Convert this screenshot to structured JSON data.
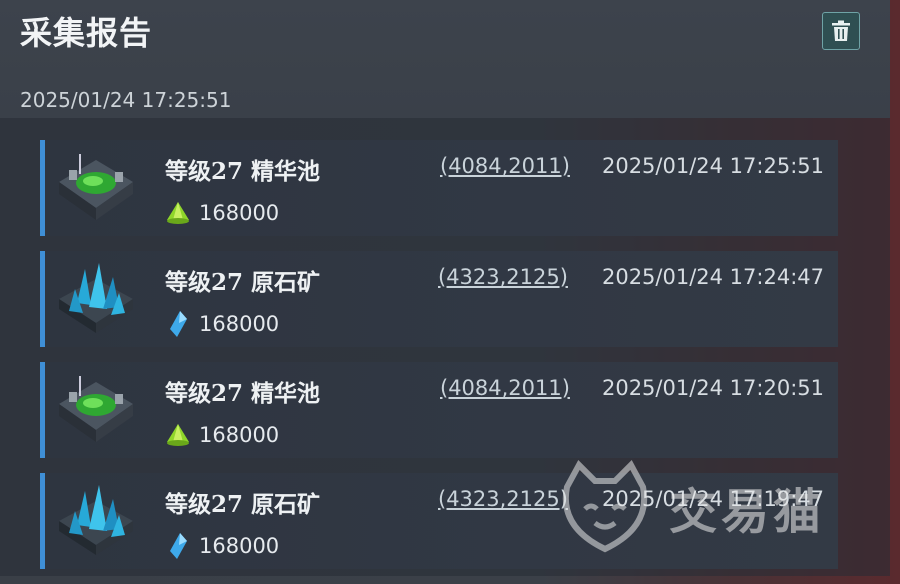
{
  "header": {
    "title": "采集报告",
    "date": "2025/01/24  17:25:51",
    "trash_icon": "trash-icon"
  },
  "reports": [
    {
      "title": "等级27  精华池",
      "coords": "(4084,2011)",
      "time": "2025/01/24 17:25:51",
      "amount": "168000",
      "icon": "essence-pool",
      "resource_icon": "green-essence-icon"
    },
    {
      "title": "等级27  原石矿",
      "coords": "(4323,2125)",
      "time": "2025/01/24 17:24:47",
      "amount": "168000",
      "icon": "crystal-mine",
      "resource_icon": "blue-crystal-icon"
    },
    {
      "title": "等级27  精华池",
      "coords": "(4084,2011)",
      "time": "2025/01/24 17:20:51",
      "amount": "168000",
      "icon": "essence-pool",
      "resource_icon": "green-essence-icon"
    },
    {
      "title": "等级27  原石矿",
      "coords": "(4323,2125)",
      "time": "2025/01/24 17:19:47",
      "amount": "168000",
      "icon": "crystal-mine",
      "resource_icon": "blue-crystal-icon"
    }
  ],
  "watermark": {
    "text": "交易猫"
  },
  "colors": {
    "accent": "#3f8fd6",
    "button": "#2f4f52"
  }
}
